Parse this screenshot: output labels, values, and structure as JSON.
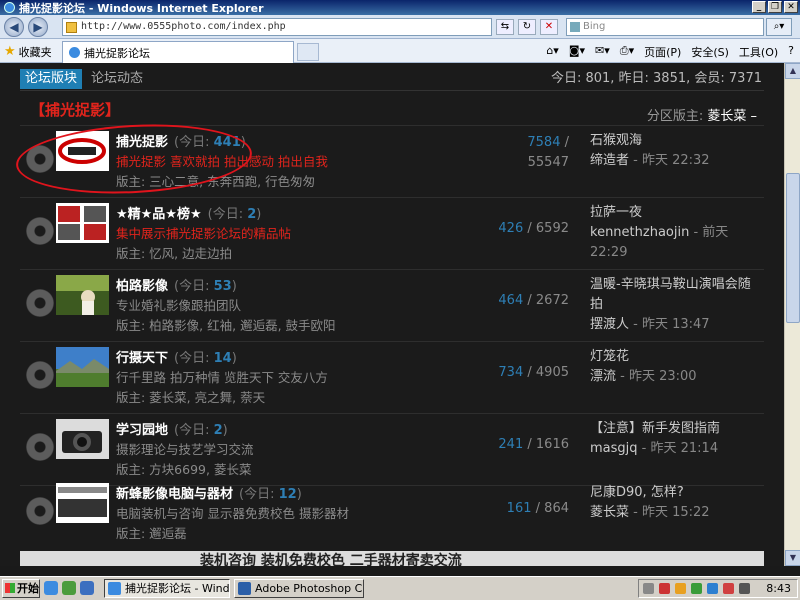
{
  "window": {
    "title": "捕光捉影论坛 - Windows Internet Explorer",
    "minimize": "_",
    "maximize": "❐",
    "close": "✕"
  },
  "browser": {
    "url": "http://www.0555photo.com/index.php",
    "search_placeholder": "Bing",
    "favorites_label": "收藏夹",
    "tab_title": "捕光捉影论坛",
    "menu_page": "页面(P)",
    "menu_safety": "安全(S)",
    "menu_tools": "工具(O)",
    "menu_help": "?"
  },
  "forum_nav": {
    "active_tab": "论坛版块",
    "tab2": "论坛动态",
    "stats": "今日: 801, 昨日: 3851, 会员: 7371"
  },
  "category": {
    "title": "【捕光捉影】",
    "moderator_label": "分区版主:",
    "moderator": "菱长菜",
    "collapse": "–"
  },
  "forums": [
    {
      "name": "捕光捉影",
      "today_label": "(今日:",
      "today": "441",
      "today_close": ")",
      "desc": "捕光捉影 喜欢就拍 拍出感动 拍出自我",
      "mods": "版主: 三心二意, 东奔西跑, 行色匆匆",
      "threads": "7584",
      "posts": "55547",
      "sep": "/",
      "last_title": "石猴观海",
      "last_user": "缔造者",
      "last_time": "- 昨天 22:32",
      "thumb_text": "捕光捉影"
    },
    {
      "name": "★精★品★榜★",
      "today_label": "(今日:",
      "today": "2",
      "today_close": ")",
      "desc": "集中展示捕光捉影论坛的精品帖",
      "mods": "版主: 忆风, 边走边拍",
      "threads": "426",
      "posts": "6592",
      "sep": "/",
      "last_title": "拉萨一夜",
      "last_user": "kennethzhaojin",
      "last_time": "- 前天 22:29",
      "thumb_text": "捉影"
    },
    {
      "name": "柏路影像",
      "today_label": "(今日:",
      "today": "53",
      "today_close": ")",
      "desc": "专业婚礼影像跟拍团队",
      "mods": "版主: 柏路影像, 红袖, 邂逅磊, 鼓手欧阳",
      "threads": "464",
      "posts": "2672",
      "sep": "/",
      "last_title": "温暖-辛晓琪马鞍山演唱会随拍",
      "last_user": "摆渡人",
      "last_time": "- 昨天 13:47",
      "thumb_text": ""
    },
    {
      "name": "行摄天下",
      "today_label": "(今日:",
      "today": "14",
      "today_close": ")",
      "desc": "行千里路 拍万种情 览胜天下 交友八方",
      "mods": "版主: 菱长菜, 亮之舞, 萘天",
      "threads": "734",
      "posts": "4905",
      "sep": "/",
      "last_title": "灯笼花",
      "last_user": "漂流",
      "last_time": "- 昨天 23:00",
      "thumb_text": ""
    },
    {
      "name": "学习园地",
      "today_label": "(今日:",
      "today": "2",
      "today_close": ")",
      "desc": "摄影理论与技艺学习交流",
      "mods": "版主: 方块6699, 菱长菜",
      "threads": "241",
      "posts": "1616",
      "sep": "/",
      "last_title": "【注意】新手发图指南",
      "last_user": "masgjq",
      "last_time": "- 昨天 21:14",
      "thumb_text": ""
    },
    {
      "name": "新蜂影像电脑与器材",
      "today_label": "(今日:",
      "today": "12",
      "today_close": ")",
      "desc": "电脑装机与咨询 显示器免费校色 摄影器材",
      "mods": "版主: 邂逅磊",
      "threads": "161",
      "posts": "864",
      "sep": "/",
      "last_title": "尼康D90, 怎样?",
      "last_user": "菱长菜",
      "last_time": "- 昨天 15:22",
      "thumb_text": "新蜂影像"
    }
  ],
  "banner": {
    "text": "装机咨询   装机免费校色   二手器材寄卖交流"
  },
  "taskbar": {
    "start": "开始",
    "task1": "捕光捉影论坛 - Wind...",
    "task2": "Adobe Photoshop CS4",
    "clock": "8:43"
  },
  "colors": {
    "accent_blue": "#1f7fb4",
    "category_red": "#e0241c",
    "page_bg": "#1b1b1b"
  }
}
